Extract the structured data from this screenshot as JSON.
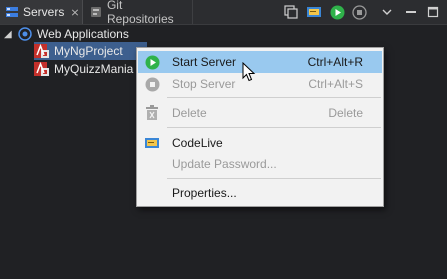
{
  "tabs": [
    {
      "label": "Servers",
      "icon": "servers-icon",
      "close": "⨯"
    },
    {
      "label": "Git Repositories",
      "icon": "git-repositories-icon"
    }
  ],
  "toolbar": [
    "new-window-icon",
    "codelive-icon",
    "start-icon",
    "stop-icon",
    "view-menu-icon",
    "minimize-icon",
    "maximize-icon"
  ],
  "tree": {
    "root": {
      "label": "Web Applications",
      "expanded": true
    },
    "projects": [
      {
        "label": "MyNgProject",
        "selected": true
      },
      {
        "label": "MyQuizzMania",
        "selected": false
      }
    ]
  },
  "context_menu": {
    "items": [
      {
        "label": "Start Server",
        "shortcut": "Ctrl+Alt+R",
        "icon": "start-server-icon",
        "enabled": true,
        "highlighted": true
      },
      {
        "label": "Stop Server",
        "shortcut": "Ctrl+Alt+S",
        "icon": "stop-server-icon",
        "enabled": false
      },
      {
        "label": "Delete",
        "shortcut": "Delete",
        "icon": "trash-icon",
        "enabled": false
      },
      {
        "label": "CodeLive",
        "shortcut": "",
        "icon": "codelive-icon",
        "enabled": true
      },
      {
        "label": "Update Password...",
        "shortcut": "",
        "icon": "",
        "enabled": false
      },
      {
        "label": "Properties...",
        "shortcut": "",
        "icon": "",
        "enabled": true
      }
    ]
  },
  "colors": {
    "background": "#202124",
    "selection": "#3d5f8e",
    "menu_highlight": "#99c9ef",
    "start_green": "#2fb24a"
  }
}
